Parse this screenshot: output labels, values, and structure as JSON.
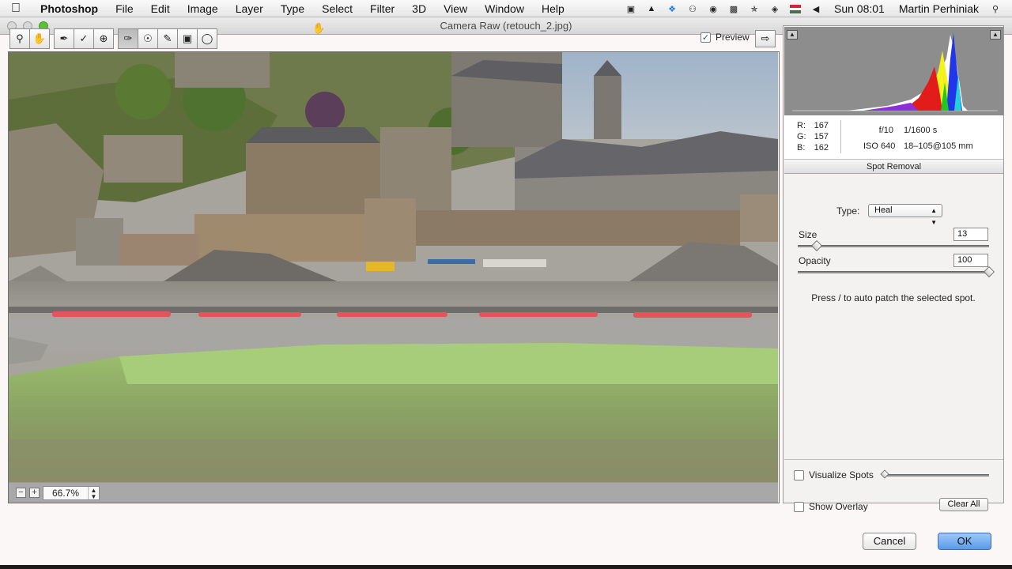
{
  "menubar": {
    "app": "Photoshop",
    "items": [
      "File",
      "Edit",
      "Image",
      "Layer",
      "Type",
      "Select",
      "Filter",
      "3D",
      "View",
      "Window",
      "Help"
    ],
    "clock": "Sun 08:01",
    "user": "Martin Perhiniak",
    "status_icons": [
      "camera-icon",
      "drive-icon",
      "dropbox-icon",
      "evernote-icon",
      "creative-cloud-icon",
      "display-icon",
      "bluetooth-icon",
      "wifi-icon",
      "flag-icon",
      "volume-icon",
      "spotlight-icon"
    ]
  },
  "window": {
    "title": "Camera Raw (retouch_2.jpg)"
  },
  "toolbar": {
    "tools": [
      "zoom-tool",
      "hand-tool",
      "white-balance-tool",
      "color-sampler-tool",
      "targeted-adjustment-tool",
      "crop-tool",
      "straighten-tool",
      "spot-removal-tool",
      "red-eye-tool",
      "adjustment-brush-tool",
      "graduated-filter-tool",
      "radial-filter-tool"
    ],
    "preview_label": "Preview",
    "preview_checked": true
  },
  "status": {
    "zoom_value": "66.7%",
    "zoom_minus": "−",
    "zoom_plus": "+"
  },
  "info": {
    "r_label": "R:",
    "r_value": "167",
    "g_label": "G:",
    "g_value": "157",
    "b_label": "B:",
    "b_value": "162",
    "aperture": "f/10",
    "shutter": "1/1600 s",
    "iso": "ISO 640",
    "lens": "18–105@105 mm"
  },
  "spot_removal": {
    "title": "Spot Removal",
    "type_label": "Type:",
    "type_value": "Heal",
    "size_label": "Size",
    "size_value": "13",
    "size_fraction": 0.1,
    "opacity_label": "Opacity",
    "opacity_value": "100",
    "opacity_fraction": 1.0,
    "hint": "Press / to auto patch the selected spot.",
    "visualize_label": "Visualize Spots",
    "overlay_label": "Show Overlay",
    "clear_all_label": "Clear All"
  },
  "dialog": {
    "cancel_label": "Cancel",
    "ok_label": "OK"
  }
}
